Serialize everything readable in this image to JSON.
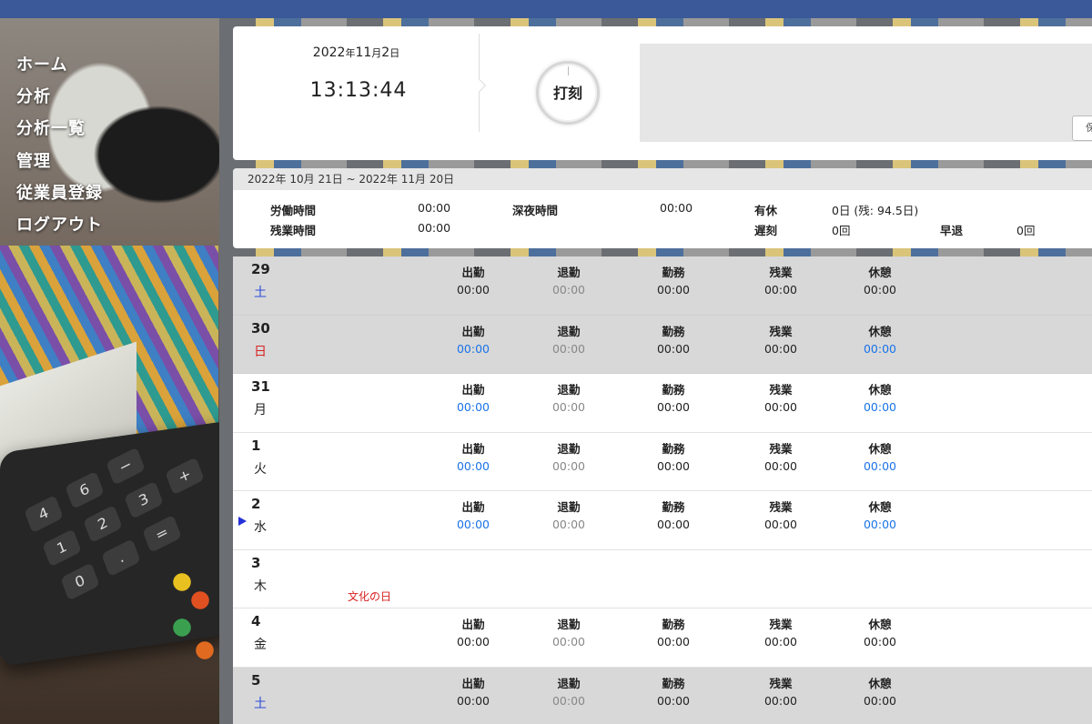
{
  "nav": [
    "ホーム",
    "分析",
    "分析一覧",
    "管理",
    "従業員登録",
    "ログアウト"
  ],
  "clock": {
    "year": "2022",
    "year_unit": "年",
    "month": "11",
    "month_unit": "月",
    "day": "2",
    "day_unit": "日",
    "time": "13:13:44",
    "punch_label": "打刻",
    "memo_button_label": "保"
  },
  "summary": {
    "period": "2022年 10月 21日 ~ 2022年 11月 20日",
    "labor_label": "労働時間",
    "labor_value": "00:00",
    "overtime_label": "残業時間",
    "overtime_value": "00:00",
    "night_label": "深夜時間",
    "night_value": "00:00",
    "paid_leave_label": "有休",
    "paid_leave_value": "0日 (残: 94.5日)",
    "late_label": "遅刻",
    "late_value": "0回",
    "early_label": "早退",
    "early_value": "0回"
  },
  "column_labels": [
    "出勤",
    "退勤",
    "勤務",
    "残業",
    "休憩"
  ],
  "days": [
    {
      "num": "29",
      "dow": "土",
      "dow_type": "sat",
      "gray": true,
      "holiday": "",
      "current": false,
      "values": [
        "00:00",
        "00:00",
        "00:00",
        "00:00",
        "00:00"
      ],
      "styles": [
        "normal",
        "muted",
        "normal",
        "normal",
        "normal"
      ]
    },
    {
      "num": "30",
      "dow": "日",
      "dow_type": "sun",
      "gray": true,
      "holiday": "",
      "current": false,
      "values": [
        "00:00",
        "00:00",
        "00:00",
        "00:00",
        "00:00"
      ],
      "styles": [
        "link",
        "muted",
        "normal",
        "normal",
        "link"
      ]
    },
    {
      "num": "31",
      "dow": "月",
      "dow_type": "",
      "gray": false,
      "holiday": "",
      "current": false,
      "values": [
        "00:00",
        "00:00",
        "00:00",
        "00:00",
        "00:00"
      ],
      "styles": [
        "link",
        "muted",
        "normal",
        "normal",
        "link"
      ]
    },
    {
      "num": "1",
      "dow": "火",
      "dow_type": "",
      "gray": false,
      "holiday": "",
      "current": false,
      "values": [
        "00:00",
        "00:00",
        "00:00",
        "00:00",
        "00:00"
      ],
      "styles": [
        "link",
        "muted",
        "normal",
        "normal",
        "link"
      ]
    },
    {
      "num": "2",
      "dow": "水",
      "dow_type": "",
      "gray": false,
      "holiday": "",
      "current": true,
      "values": [
        "00:00",
        "00:00",
        "00:00",
        "00:00",
        "00:00"
      ],
      "styles": [
        "link",
        "muted",
        "normal",
        "normal",
        "link"
      ]
    },
    {
      "num": "3",
      "dow": "木",
      "dow_type": "",
      "gray": false,
      "holiday": "文化の日",
      "current": false,
      "values": [],
      "styles": []
    },
    {
      "num": "4",
      "dow": "金",
      "dow_type": "",
      "gray": false,
      "holiday": "",
      "current": false,
      "values": [
        "00:00",
        "00:00",
        "00:00",
        "00:00",
        "00:00"
      ],
      "styles": [
        "normal",
        "muted",
        "normal",
        "normal",
        "normal"
      ]
    },
    {
      "num": "5",
      "dow": "土",
      "dow_type": "sat",
      "gray": true,
      "holiday": "",
      "current": false,
      "values": [
        "00:00",
        "00:00",
        "00:00",
        "00:00",
        "00:00"
      ],
      "styles": [
        "normal",
        "muted",
        "normal",
        "normal",
        "normal"
      ]
    }
  ]
}
